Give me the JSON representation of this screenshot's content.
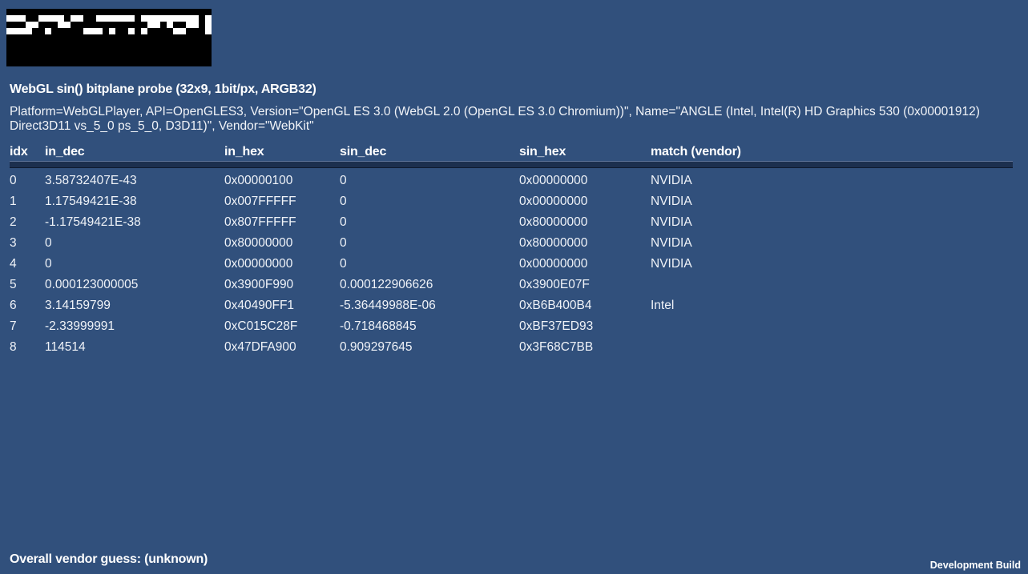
{
  "title": "WebGL sin() bitplane probe (32x9, 1bit/px, ARGB32)",
  "platform_line": "Platform=WebGLPlayer, API=OpenGLES3, Version=\"OpenGL ES 3.0 (WebGL 2.0 (OpenGL ES 3.0 Chromium))\", Name=\"ANGLE (Intel, Intel(R) HD Graphics 530 (0x00001912) Direct3D11 vs_5_0 ps_5_0, D3D11)\", Vendor=\"WebKit\"",
  "table": {
    "columns": [
      "idx",
      "in_dec",
      "in_hex",
      "sin_dec",
      "sin_hex",
      "match (vendor)"
    ],
    "rows": [
      {
        "idx": "0",
        "in_dec": "3.58732407E-43",
        "in_hex": "0x00000100",
        "sin_dec": "0",
        "sin_hex": "0x00000000",
        "match": "NVIDIA"
      },
      {
        "idx": "1",
        "in_dec": "1.17549421E-38",
        "in_hex": "0x007FFFFF",
        "sin_dec": "0",
        "sin_hex": "0x00000000",
        "match": "NVIDIA"
      },
      {
        "idx": "2",
        "in_dec": "-1.17549421E-38",
        "in_hex": "0x807FFFFF",
        "sin_dec": "0",
        "sin_hex": "0x80000000",
        "match": "NVIDIA"
      },
      {
        "idx": "3",
        "in_dec": "0",
        "in_hex": "0x80000000",
        "sin_dec": "0",
        "sin_hex": "0x80000000",
        "match": "NVIDIA"
      },
      {
        "idx": "4",
        "in_dec": "0",
        "in_hex": "0x00000000",
        "sin_dec": "0",
        "sin_hex": "0x00000000",
        "match": "NVIDIA"
      },
      {
        "idx": "5",
        "in_dec": "0.000123000005",
        "in_hex": "0x3900F990",
        "sin_dec": "0.000122906626",
        "sin_hex": "0x3900E07F",
        "match": ""
      },
      {
        "idx": "6",
        "in_dec": "3.14159799",
        "in_hex": "0x40490FF1",
        "sin_dec": "-5.36449988E-06",
        "sin_hex": "0xB6B400B4",
        "match": "Intel"
      },
      {
        "idx": "7",
        "in_dec": "-2.33999991",
        "in_hex": "0xC015C28F",
        "sin_dec": "-0.718468845",
        "sin_hex": "0xBF37ED93",
        "match": ""
      },
      {
        "idx": "8",
        "in_dec": "114514",
        "in_hex": "0x47DFA900",
        "sin_dec": "0.909297645",
        "sin_hex": "0x3F68C7BB",
        "match": ""
      }
    ]
  },
  "footer": {
    "vendor_guess": "Overall vendor guess: (unknown)",
    "dev_build": "Development Build"
  },
  "bitplane": [
    "00000000000000000000000000000000",
    "11100111101100111111011111111101",
    "00011000110000000000001101001101",
    "11110010000011101001010000110001",
    "00000000000000000000000000000000",
    "00000000000000000000000000000000",
    "00000000000000000000000000000000",
    "00000000000000000000000000000000",
    "00000000000000000000000000000000"
  ],
  "colors": {
    "background": "#31507c",
    "text": "#ffffff",
    "rule": "#1c2f4e"
  }
}
